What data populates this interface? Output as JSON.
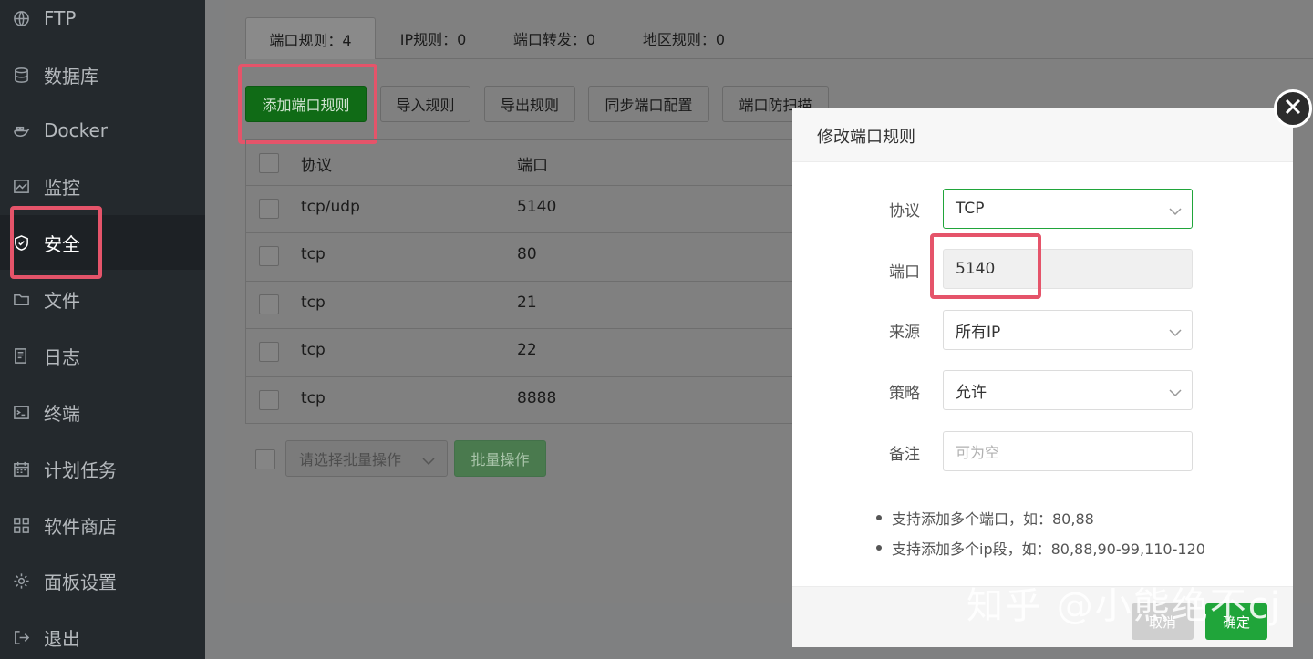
{
  "sidebar": {
    "items": [
      {
        "label": "FTP",
        "icon": "globe-icon"
      },
      {
        "label": "数据库",
        "icon": "database-icon"
      },
      {
        "label": "Docker",
        "icon": "docker-icon"
      },
      {
        "label": "监控",
        "icon": "monitor-chart-icon"
      },
      {
        "label": "安全",
        "icon": "shield-icon"
      },
      {
        "label": "文件",
        "icon": "folder-icon"
      },
      {
        "label": "日志",
        "icon": "log-icon"
      },
      {
        "label": "终端",
        "icon": "terminal-icon"
      },
      {
        "label": "计划任务",
        "icon": "calendar-icon"
      },
      {
        "label": "软件商店",
        "icon": "apps-grid-icon"
      },
      {
        "label": "面板设置",
        "icon": "gear-icon"
      },
      {
        "label": "退出",
        "icon": "logout-icon"
      }
    ],
    "active": "安全"
  },
  "tabs": [
    {
      "label": "端口规则：4"
    },
    {
      "label": "IP规则：0"
    },
    {
      "label": "端口转发：0"
    },
    {
      "label": "地区规则：0"
    }
  ],
  "toolbar": {
    "add": "添加端口规则",
    "import": "导入规则",
    "export": "导出规则",
    "sync": "同步端口配置",
    "antiscan": "端口防扫描"
  },
  "table": {
    "headers": [
      "协议",
      "端口"
    ],
    "rows": [
      {
        "protocol": "tcp/udp",
        "port": "5140"
      },
      {
        "protocol": "tcp",
        "port": "80"
      },
      {
        "protocol": "tcp",
        "port": "21"
      },
      {
        "protocol": "tcp",
        "port": "22"
      },
      {
        "protocol": "tcp",
        "port": "8888"
      }
    ]
  },
  "batch": {
    "placeholder": "请选择批量操作",
    "button": "批量操作"
  },
  "dialog": {
    "title": "修改端口规则",
    "protocol_label": "协议",
    "protocol_value": "TCP",
    "port_label": "端口",
    "port_value": "5140",
    "source_label": "来源",
    "source_value": "所有IP",
    "policy_label": "策略",
    "policy_value": "允许",
    "remark_label": "备注",
    "remark_placeholder": "可为空",
    "tips": [
      "支持添加多个端口，如：80,88",
      "支持添加多个ip段，如：80,88,90-99,110-120"
    ],
    "cancel": "取消",
    "confirm": "确定"
  },
  "watermark": "知乎 @小熊绝不cj",
  "colors": {
    "accent": "#20a53a",
    "highlight": "#e5546a"
  }
}
